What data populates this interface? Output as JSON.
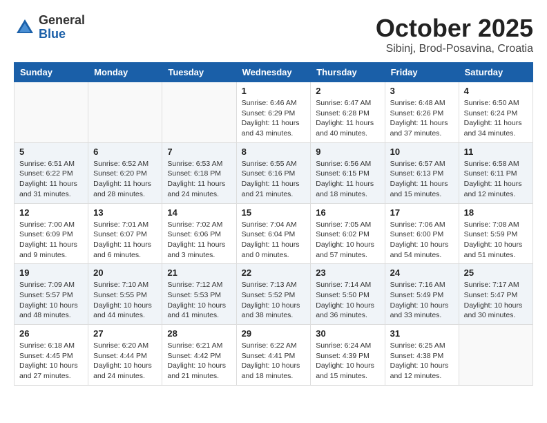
{
  "header": {
    "logo_general": "General",
    "logo_blue": "Blue",
    "month_title": "October 2025",
    "location": "Sibinj, Brod-Posavina, Croatia"
  },
  "weekdays": [
    "Sunday",
    "Monday",
    "Tuesday",
    "Wednesday",
    "Thursday",
    "Friday",
    "Saturday"
  ],
  "weeks": [
    [
      {
        "day": "",
        "info": ""
      },
      {
        "day": "",
        "info": ""
      },
      {
        "day": "",
        "info": ""
      },
      {
        "day": "1",
        "info": "Sunrise: 6:46 AM\nSunset: 6:29 PM\nDaylight: 11 hours\nand 43 minutes."
      },
      {
        "day": "2",
        "info": "Sunrise: 6:47 AM\nSunset: 6:28 PM\nDaylight: 11 hours\nand 40 minutes."
      },
      {
        "day": "3",
        "info": "Sunrise: 6:48 AM\nSunset: 6:26 PM\nDaylight: 11 hours\nand 37 minutes."
      },
      {
        "day": "4",
        "info": "Sunrise: 6:50 AM\nSunset: 6:24 PM\nDaylight: 11 hours\nand 34 minutes."
      }
    ],
    [
      {
        "day": "5",
        "info": "Sunrise: 6:51 AM\nSunset: 6:22 PM\nDaylight: 11 hours\nand 31 minutes."
      },
      {
        "day": "6",
        "info": "Sunrise: 6:52 AM\nSunset: 6:20 PM\nDaylight: 11 hours\nand 28 minutes."
      },
      {
        "day": "7",
        "info": "Sunrise: 6:53 AM\nSunset: 6:18 PM\nDaylight: 11 hours\nand 24 minutes."
      },
      {
        "day": "8",
        "info": "Sunrise: 6:55 AM\nSunset: 6:16 PM\nDaylight: 11 hours\nand 21 minutes."
      },
      {
        "day": "9",
        "info": "Sunrise: 6:56 AM\nSunset: 6:15 PM\nDaylight: 11 hours\nand 18 minutes."
      },
      {
        "day": "10",
        "info": "Sunrise: 6:57 AM\nSunset: 6:13 PM\nDaylight: 11 hours\nand 15 minutes."
      },
      {
        "day": "11",
        "info": "Sunrise: 6:58 AM\nSunset: 6:11 PM\nDaylight: 11 hours\nand 12 minutes."
      }
    ],
    [
      {
        "day": "12",
        "info": "Sunrise: 7:00 AM\nSunset: 6:09 PM\nDaylight: 11 hours\nand 9 minutes."
      },
      {
        "day": "13",
        "info": "Sunrise: 7:01 AM\nSunset: 6:07 PM\nDaylight: 11 hours\nand 6 minutes."
      },
      {
        "day": "14",
        "info": "Sunrise: 7:02 AM\nSunset: 6:06 PM\nDaylight: 11 hours\nand 3 minutes."
      },
      {
        "day": "15",
        "info": "Sunrise: 7:04 AM\nSunset: 6:04 PM\nDaylight: 11 hours\nand 0 minutes."
      },
      {
        "day": "16",
        "info": "Sunrise: 7:05 AM\nSunset: 6:02 PM\nDaylight: 10 hours\nand 57 minutes."
      },
      {
        "day": "17",
        "info": "Sunrise: 7:06 AM\nSunset: 6:00 PM\nDaylight: 10 hours\nand 54 minutes."
      },
      {
        "day": "18",
        "info": "Sunrise: 7:08 AM\nSunset: 5:59 PM\nDaylight: 10 hours\nand 51 minutes."
      }
    ],
    [
      {
        "day": "19",
        "info": "Sunrise: 7:09 AM\nSunset: 5:57 PM\nDaylight: 10 hours\nand 48 minutes."
      },
      {
        "day": "20",
        "info": "Sunrise: 7:10 AM\nSunset: 5:55 PM\nDaylight: 10 hours\nand 44 minutes."
      },
      {
        "day": "21",
        "info": "Sunrise: 7:12 AM\nSunset: 5:53 PM\nDaylight: 10 hours\nand 41 minutes."
      },
      {
        "day": "22",
        "info": "Sunrise: 7:13 AM\nSunset: 5:52 PM\nDaylight: 10 hours\nand 38 minutes."
      },
      {
        "day": "23",
        "info": "Sunrise: 7:14 AM\nSunset: 5:50 PM\nDaylight: 10 hours\nand 36 minutes."
      },
      {
        "day": "24",
        "info": "Sunrise: 7:16 AM\nSunset: 5:49 PM\nDaylight: 10 hours\nand 33 minutes."
      },
      {
        "day": "25",
        "info": "Sunrise: 7:17 AM\nSunset: 5:47 PM\nDaylight: 10 hours\nand 30 minutes."
      }
    ],
    [
      {
        "day": "26",
        "info": "Sunrise: 6:18 AM\nSunset: 4:45 PM\nDaylight: 10 hours\nand 27 minutes."
      },
      {
        "day": "27",
        "info": "Sunrise: 6:20 AM\nSunset: 4:44 PM\nDaylight: 10 hours\nand 24 minutes."
      },
      {
        "day": "28",
        "info": "Sunrise: 6:21 AM\nSunset: 4:42 PM\nDaylight: 10 hours\nand 21 minutes."
      },
      {
        "day": "29",
        "info": "Sunrise: 6:22 AM\nSunset: 4:41 PM\nDaylight: 10 hours\nand 18 minutes."
      },
      {
        "day": "30",
        "info": "Sunrise: 6:24 AM\nSunset: 4:39 PM\nDaylight: 10 hours\nand 15 minutes."
      },
      {
        "day": "31",
        "info": "Sunrise: 6:25 AM\nSunset: 4:38 PM\nDaylight: 10 hours\nand 12 minutes."
      },
      {
        "day": "",
        "info": ""
      }
    ]
  ]
}
